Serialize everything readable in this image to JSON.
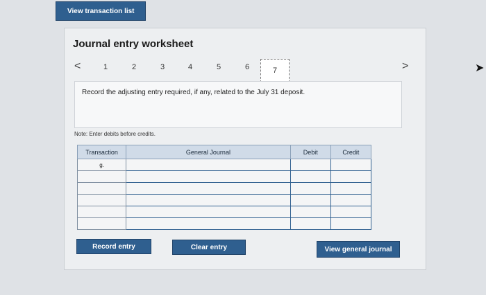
{
  "top_button": "View transaction list",
  "worksheet": {
    "title": "Journal entry worksheet",
    "nav_prev": "<",
    "nav_next": ">",
    "steps": [
      "1",
      "2",
      "3",
      "4",
      "5",
      "6",
      "7"
    ],
    "active_step": "7",
    "prompt": "Record the adjusting entry required, if any, related to the July 31 deposit.",
    "note": "Note: Enter debits before credits."
  },
  "table": {
    "headers": [
      "Transaction",
      "General Journal",
      "Debit",
      "Credit"
    ],
    "rows": [
      {
        "transaction": "g.",
        "account": "",
        "debit": "",
        "credit": ""
      },
      {
        "transaction": "",
        "account": "",
        "debit": "",
        "credit": ""
      },
      {
        "transaction": "",
        "account": "",
        "debit": "",
        "credit": ""
      },
      {
        "transaction": "",
        "account": "",
        "debit": "",
        "credit": ""
      },
      {
        "transaction": "",
        "account": "",
        "debit": "",
        "credit": ""
      },
      {
        "transaction": "",
        "account": "",
        "debit": "",
        "credit": ""
      }
    ]
  },
  "buttons": {
    "record": "Record entry",
    "clear": "Clear entry",
    "view_journal": "View general journal"
  },
  "colors": {
    "button": "#2f5f8f",
    "header": "#d0dbe8"
  }
}
